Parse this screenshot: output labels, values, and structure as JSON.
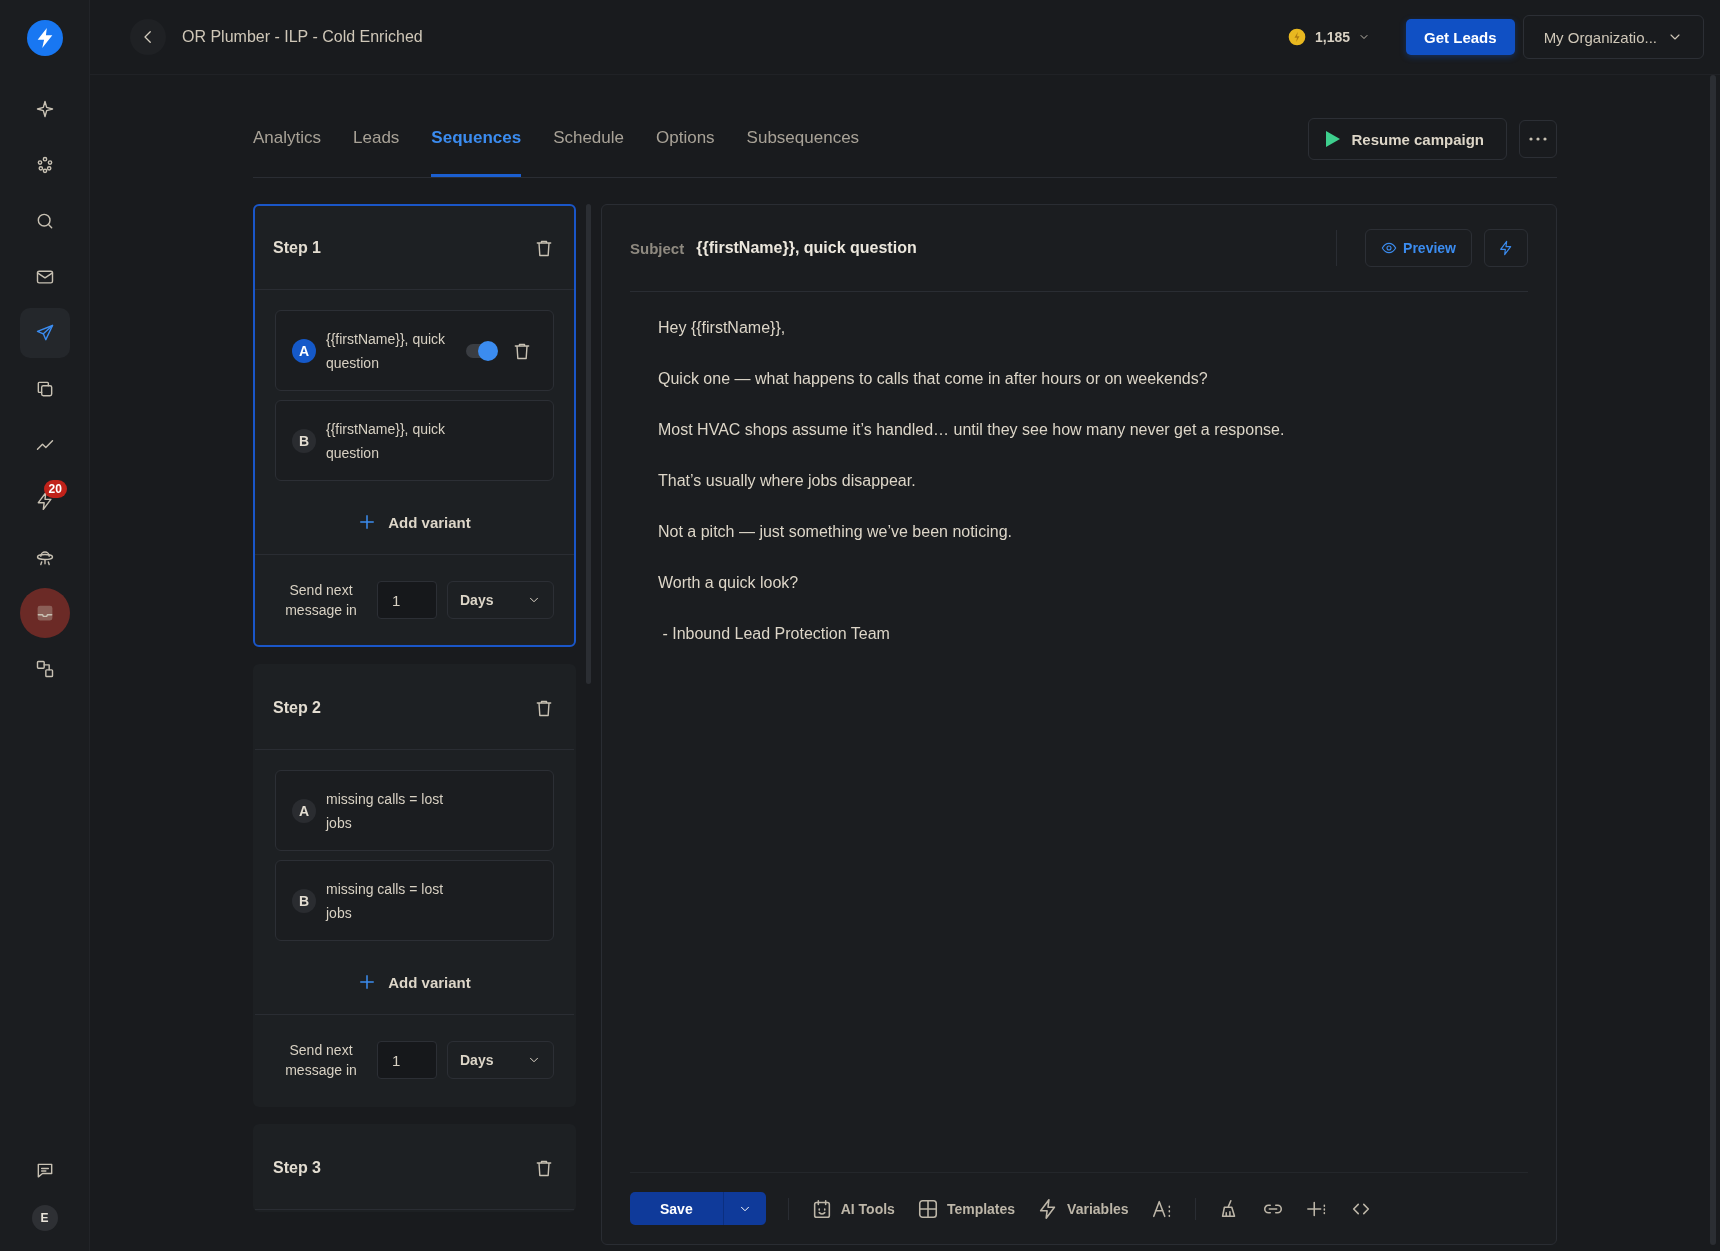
{
  "sidebar": {
    "items": [
      {
        "selected": false,
        "highlighted": false
      },
      {
        "selected": false,
        "highlighted": false
      },
      {
        "selected": false,
        "highlighted": false
      },
      {
        "selected": false,
        "highlighted": false
      },
      {
        "selected": true,
        "highlighted": false
      },
      {
        "selected": false,
        "highlighted": false
      },
      {
        "selected": false,
        "highlighted": false
      },
      {
        "selected": false,
        "highlighted": false,
        "badge": "20"
      },
      {
        "selected": false,
        "highlighted": false
      },
      {
        "selected": false,
        "highlighted": true
      },
      {
        "selected": false,
        "highlighted": false
      }
    ],
    "bottom": {
      "avatar": "E"
    }
  },
  "header": {
    "title": "OR Plumber - ILP - Cold Enriched",
    "credits": "1,185",
    "get_leads": "Get Leads",
    "organization": "My Organizatio..."
  },
  "tabs": [
    {
      "label": "Analytics",
      "selected": false
    },
    {
      "label": "Leads",
      "selected": false
    },
    {
      "label": "Sequences",
      "selected": true
    },
    {
      "label": "Schedule",
      "selected": false
    },
    {
      "label": "Options",
      "selected": false
    },
    {
      "label": "Subsequences",
      "selected": false
    }
  ],
  "resume_button": "Resume campaign",
  "steps": [
    {
      "title": "Step 1",
      "selected": true,
      "variants": [
        {
          "letter": "A",
          "subject": "{{firstName}}, quick question",
          "selected": true,
          "toggle": {
            "on": true
          }
        },
        {
          "letter": "B",
          "subject": "{{firstName}}, quick question",
          "selected": false
        }
      ],
      "add_variant": "Add variant",
      "delay_label": "Send next message in",
      "delay_value": "1",
      "delay_unit": "Days"
    },
    {
      "title": "Step 2",
      "selected": false,
      "variants": [
        {
          "letter": "A",
          "subject": "missing calls = lost jobs",
          "selected": false
        },
        {
          "letter": "B",
          "subject": "missing calls = lost jobs",
          "selected": false
        }
      ],
      "add_variant": "Add variant",
      "delay_label": "Send next message in",
      "delay_value": "1",
      "delay_unit": "Days"
    },
    {
      "title": "Step 3",
      "selected": false
    }
  ],
  "editor": {
    "subject_label": "Subject",
    "subject": "{{firstName}}, quick question",
    "preview": "Preview",
    "body": [
      "Hey {{firstName}},",
      "Quick one — what happens to calls that come in after hours or on weekends?",
      "Most HVAC shops assume it’s handled… until they see how many never get a response.",
      "That’s usually where jobs disappear.",
      "Not a pitch — just something we’ve been noticing.",
      "Worth a quick look?",
      " - Inbound Lead Protection Team"
    ],
    "toolbar": {
      "save": "Save",
      "tools": [
        {
          "kind": "ai",
          "label": "AI Tools"
        },
        {
          "kind": "templates",
          "label": "Templates"
        },
        {
          "kind": "variables",
          "label": "Variables"
        },
        {
          "kind": "font"
        },
        {
          "kind": "brush"
        },
        {
          "kind": "link"
        },
        {
          "kind": "insert"
        },
        {
          "kind": "code"
        }
      ]
    }
  }
}
